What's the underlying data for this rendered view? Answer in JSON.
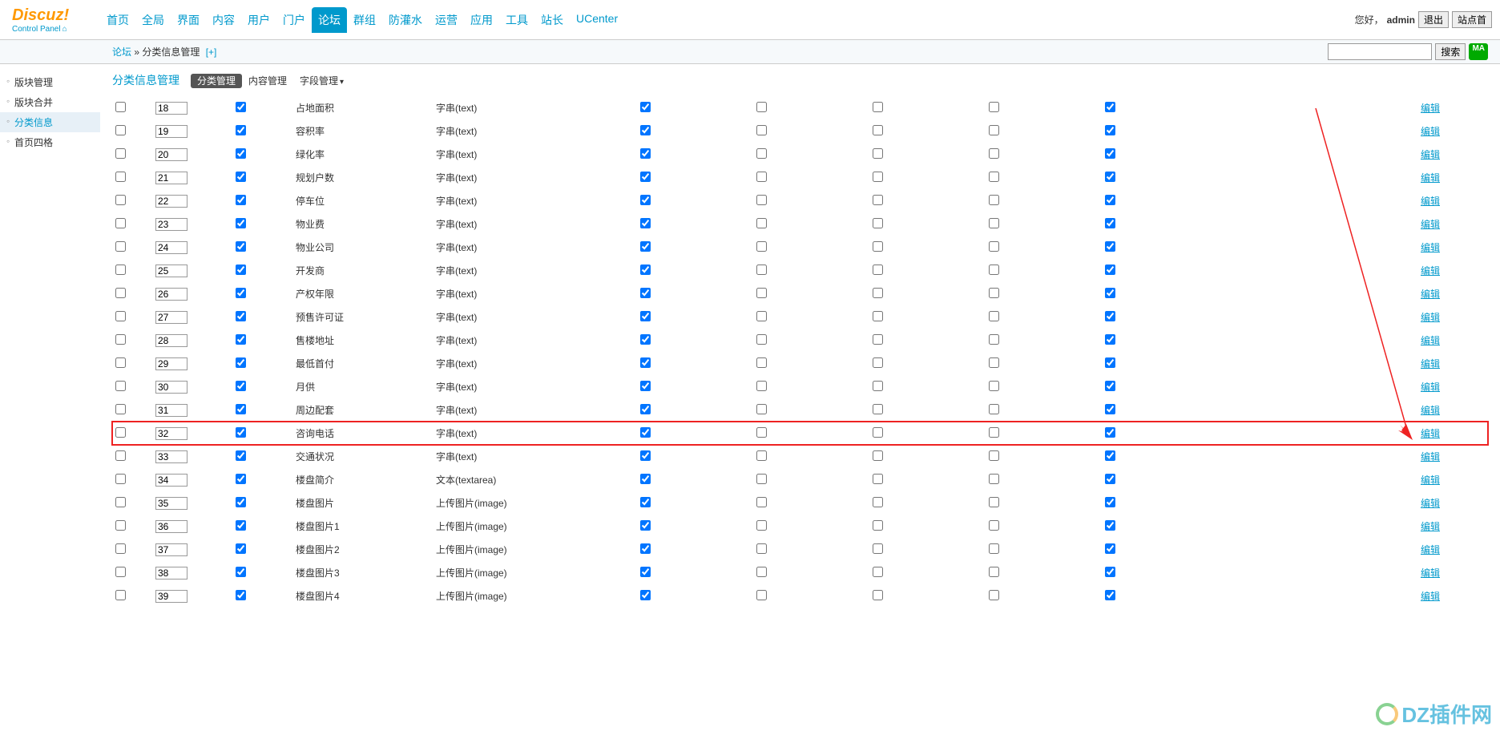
{
  "logo": {
    "main": "Discuz!",
    "sub": "Control Panel"
  },
  "topnav": [
    "首页",
    "全局",
    "界面",
    "内容",
    "用户",
    "门户",
    "论坛",
    "群组",
    "防灌水",
    "运营",
    "应用",
    "工具",
    "站长",
    "UCenter"
  ],
  "topnav_active": 6,
  "topright": {
    "greet": "您好，",
    "user": "admin",
    "logout": "退出",
    "site": "站点首"
  },
  "breadcrumb": {
    "a": "论坛",
    "sep": " » ",
    "b": "分类信息管理",
    "add": "[+]"
  },
  "search": {
    "button": "搜索",
    "ma": "MA"
  },
  "sidebar": {
    "items": [
      "版块管理",
      "版块合并",
      "分类信息",
      "首页四格"
    ],
    "active": 2
  },
  "subtabs": {
    "title": "分类信息管理",
    "tabs": [
      "分类管理",
      "内容管理",
      "字段管理"
    ],
    "active": 0,
    "arrow_idx": 2
  },
  "edit_label": "编辑",
  "rows": [
    {
      "order": "18",
      "name": "占地面积",
      "type": "字串(text)",
      "c1": true,
      "c4": true,
      "hl": false
    },
    {
      "order": "19",
      "name": "容积率",
      "type": "字串(text)",
      "c1": true,
      "c4": true,
      "hl": false
    },
    {
      "order": "20",
      "name": "绿化率",
      "type": "字串(text)",
      "c1": true,
      "c4": true,
      "hl": false
    },
    {
      "order": "21",
      "name": "规划户数",
      "type": "字串(text)",
      "c1": true,
      "c4": true,
      "hl": false
    },
    {
      "order": "22",
      "name": "停车位",
      "type": "字串(text)",
      "c1": true,
      "c4": true,
      "hl": false
    },
    {
      "order": "23",
      "name": "物业费",
      "type": "字串(text)",
      "c1": true,
      "c4": true,
      "hl": false
    },
    {
      "order": "24",
      "name": "物业公司",
      "type": "字串(text)",
      "c1": true,
      "c4": true,
      "hl": false
    },
    {
      "order": "25",
      "name": "开发商",
      "type": "字串(text)",
      "c1": true,
      "c4": true,
      "hl": false
    },
    {
      "order": "26",
      "name": "产权年限",
      "type": "字串(text)",
      "c1": true,
      "c4": true,
      "hl": false
    },
    {
      "order": "27",
      "name": "预售许可证",
      "type": "字串(text)",
      "c1": true,
      "c4": true,
      "hl": false
    },
    {
      "order": "28",
      "name": "售楼地址",
      "type": "字串(text)",
      "c1": true,
      "c4": true,
      "hl": false
    },
    {
      "order": "29",
      "name": "最低首付",
      "type": "字串(text)",
      "c1": true,
      "c4": true,
      "hl": false
    },
    {
      "order": "30",
      "name": "月供",
      "type": "字串(text)",
      "c1": true,
      "c4": true,
      "hl": false
    },
    {
      "order": "31",
      "name": "周边配套",
      "type": "字串(text)",
      "c1": true,
      "c4": true,
      "hl": false
    },
    {
      "order": "32",
      "name": "咨询电话",
      "type": "字串(text)",
      "c1": true,
      "c4": true,
      "hl": true
    },
    {
      "order": "33",
      "name": "交通状况",
      "type": "字串(text)",
      "c1": true,
      "c4": true,
      "hl": false
    },
    {
      "order": "34",
      "name": "楼盘简介",
      "type": "文本(textarea)",
      "c1": true,
      "c4": true,
      "hl": false
    },
    {
      "order": "35",
      "name": "楼盘图片",
      "type": "上传图片(image)",
      "c1": true,
      "c4": true,
      "hl": false
    },
    {
      "order": "36",
      "name": "楼盘图片1",
      "type": "上传图片(image)",
      "c1": true,
      "c4": true,
      "hl": false
    },
    {
      "order": "37",
      "name": "楼盘图片2",
      "type": "上传图片(image)",
      "c1": true,
      "c4": true,
      "hl": false
    },
    {
      "order": "38",
      "name": "楼盘图片3",
      "type": "上传图片(image)",
      "c1": true,
      "c4": true,
      "hl": false
    },
    {
      "order": "39",
      "name": "楼盘图片4",
      "type": "上传图片(image)",
      "c1": true,
      "c4": true,
      "hl": false
    }
  ],
  "watermark": "DZ插件网"
}
